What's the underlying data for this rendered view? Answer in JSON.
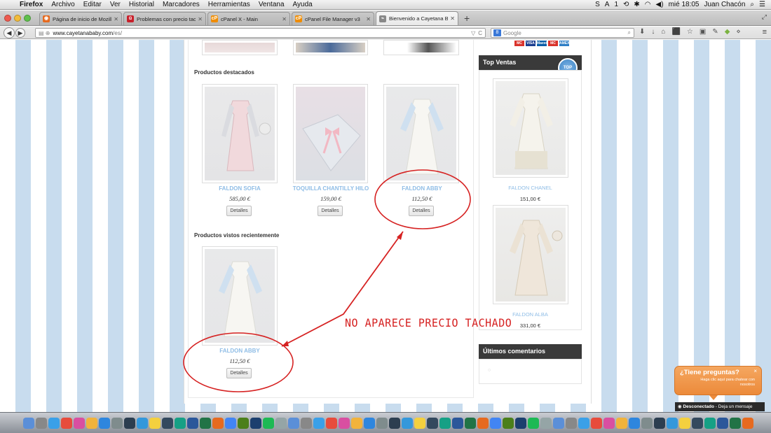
{
  "menubar": {
    "app": "Firefox",
    "items": [
      "Archivo",
      "Editar",
      "Ver",
      "Historial",
      "Marcadores",
      "Herramientas",
      "Ventana",
      "Ayuda"
    ],
    "status_day_time": "mié 18:05",
    "status_user": "Juan Chacón",
    "status_misc": "1"
  },
  "tabs": [
    {
      "label": "Página de inicio de Mozill...",
      "fav_color": "#e66a1f",
      "fav_glyph": "◉"
    },
    {
      "label": "Problemas con precio tach...",
      "fav_color": "#c8202b",
      "fav_glyph": "ü"
    },
    {
      "label": "cPanel X - Main",
      "fav_color": "#f08c00",
      "fav_glyph": "cP"
    },
    {
      "label": "cPanel File Manager v3",
      "fav_color": "#f08c00",
      "fav_glyph": "cP"
    },
    {
      "label": "Bienvenido a Cayetana Baby",
      "fav_color": "#888888",
      "fav_glyph": "⌁"
    }
  ],
  "toolbar": {
    "url_host": "www.cayetanababy.com",
    "url_path": "/es/",
    "search_placeholder": "Google"
  },
  "featured": {
    "title": "Productos destacados",
    "products": [
      {
        "name": "FALDON SOFIA",
        "price": "585,00 €",
        "button": "Detalles"
      },
      {
        "name": "TOQUILLA CHANTILLY HILO",
        "price": "159,00 €",
        "button": "Detalles"
      },
      {
        "name": "FALDON ABBY",
        "price": "112,50 €",
        "button": "Detalles"
      }
    ]
  },
  "recent": {
    "title": "Productos vistos recientemente",
    "products": [
      {
        "name": "FALDON ABBY",
        "price": "112,50 €",
        "button": "Detalles"
      }
    ]
  },
  "sidebar": {
    "top_ventas_title": "Top Ventas",
    "badge": "TOP",
    "cards": [
      "MC",
      "VISA",
      "Maestro",
      "MC",
      "AMEX"
    ],
    "products": [
      {
        "name": "FALDON CHANEL",
        "price": "151,00 €"
      },
      {
        "name": "FALDON ALBA",
        "price": "331,00 €"
      }
    ],
    "comments_title": "Últimos comentarios"
  },
  "chat": {
    "title": "¿Tiene preguntas?",
    "subtitle": "Haga clic aquí para chatear con nosotros",
    "close": "×",
    "status": "Desconectado",
    "status_link": "Deja un mensaje"
  },
  "annotation": {
    "text": "NO APARECE PRECIO TACHADO",
    "color": "#d62222"
  },
  "accent": {
    "product_link": "#8fbde6",
    "stripe": "#c8dcee"
  },
  "dock_icons": [
    "finder",
    "launchpad",
    "safari",
    "calendar",
    "itunes",
    "photos",
    "app-store",
    "system-preferences",
    "activity-monitor",
    "mail",
    "notes",
    "terminal",
    "preview",
    "word",
    "excel",
    "firefox",
    "chrome",
    "dreamweaver",
    "photoshop",
    "spotify",
    "trash"
  ]
}
